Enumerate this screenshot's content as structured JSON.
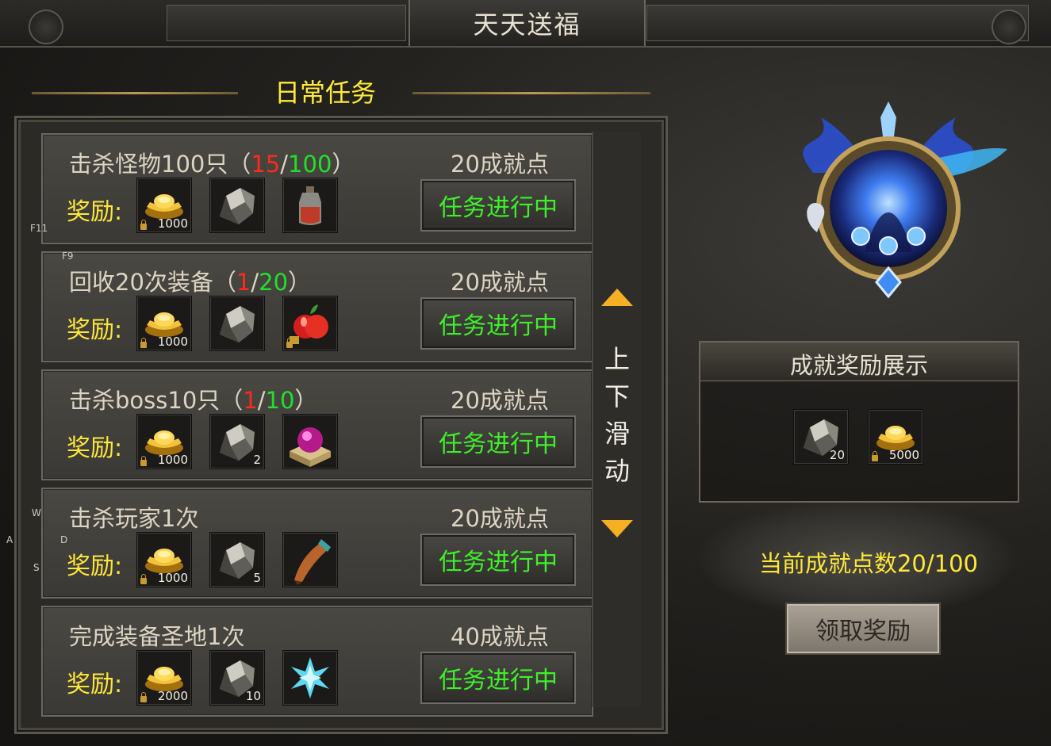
{
  "window": {
    "title": "天天送福"
  },
  "section": {
    "title": "日常任务"
  },
  "reward_label": "奖励:",
  "tasks": [
    {
      "title_prefix": "击杀怪物100只（",
      "current": "15",
      "sep": "/",
      "total": "100",
      "title_suffix": "）",
      "points": "20成就点",
      "status": "任务进行中",
      "rewards": [
        {
          "icon": "gold-ingot-icon",
          "count": "1000",
          "locked": true
        },
        {
          "icon": "ore-icon",
          "count": ""
        },
        {
          "icon": "potion-bottle-icon",
          "count": ""
        }
      ]
    },
    {
      "title_prefix": "回收20次装备（",
      "current": "1",
      "sep": "/",
      "total": "20",
      "title_suffix": "）",
      "points": "20成就点",
      "status": "任务进行中",
      "rewards": [
        {
          "icon": "gold-ingot-icon",
          "count": "1000",
          "locked": true
        },
        {
          "icon": "ore-icon",
          "count": ""
        },
        {
          "icon": "red-apple-icon",
          "count": "",
          "locked": true
        }
      ]
    },
    {
      "title_prefix": "击杀boss10只（",
      "current": "1",
      "sep": "/",
      "total": "10",
      "title_suffix": "）",
      "points": "20成就点",
      "status": "任务进行中",
      "rewards": [
        {
          "icon": "gold-ingot-icon",
          "count": "1000",
          "locked": true
        },
        {
          "icon": "ore-icon",
          "count": "2"
        },
        {
          "icon": "magic-orb-chest-icon",
          "count": ""
        }
      ]
    },
    {
      "title_prefix": "击杀玩家1次",
      "current": "",
      "sep": "",
      "total": "",
      "title_suffix": "",
      "points": "20成就点",
      "status": "任务进行中",
      "rewards": [
        {
          "icon": "gold-ingot-icon",
          "count": "1000",
          "locked": true
        },
        {
          "icon": "ore-icon",
          "count": "5"
        },
        {
          "icon": "horn-icon",
          "count": ""
        }
      ]
    },
    {
      "title_prefix": "完成装备圣地1次",
      "current": "",
      "sep": "",
      "total": "",
      "title_suffix": "",
      "points": "40成就点",
      "status": "任务进行中",
      "rewards": [
        {
          "icon": "gold-ingot-icon",
          "count": "2000",
          "locked": true
        },
        {
          "icon": "ore-icon",
          "count": "10"
        },
        {
          "icon": "ice-crystal-icon",
          "count": ""
        }
      ]
    }
  ],
  "scroll_hint": [
    "上",
    "下",
    "滑",
    "动"
  ],
  "hotkeys": {
    "f11": "F11",
    "f9": "F9",
    "w": "W",
    "a": "A",
    "s": "S",
    "d": "D"
  },
  "showcase": {
    "title": "成就奖励展示",
    "rewards": [
      {
        "icon": "ore-icon",
        "count": "20"
      },
      {
        "icon": "gold-ingot-icon",
        "count": "5000",
        "locked": true
      }
    ]
  },
  "achievement": {
    "text": "当前成就点数20/100",
    "current": 20,
    "total": 100
  },
  "claim_button": "领取奖励",
  "colors": {
    "accent_yellow": "#ffe83a",
    "progress_green": "#22e02a",
    "progress_red": "#ff2a1a",
    "status_green": "#3ff02a"
  }
}
